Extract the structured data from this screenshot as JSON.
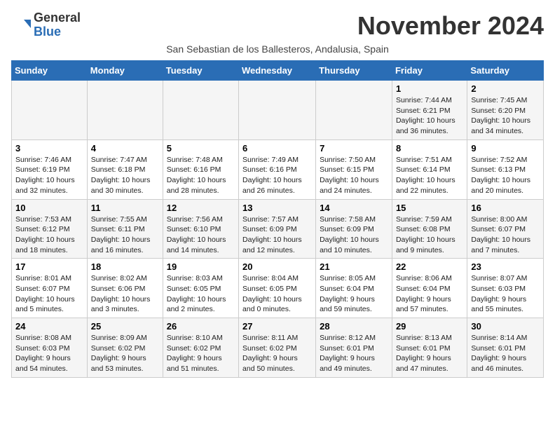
{
  "logo": {
    "general": "General",
    "blue": "Blue"
  },
  "title": "November 2024",
  "subtitle": "San Sebastian de los Ballesteros, Andalusia, Spain",
  "headers": [
    "Sunday",
    "Monday",
    "Tuesday",
    "Wednesday",
    "Thursday",
    "Friday",
    "Saturday"
  ],
  "weeks": [
    [
      {
        "day": "",
        "info": ""
      },
      {
        "day": "",
        "info": ""
      },
      {
        "day": "",
        "info": ""
      },
      {
        "day": "",
        "info": ""
      },
      {
        "day": "",
        "info": ""
      },
      {
        "day": "1",
        "info": "Sunrise: 7:44 AM\nSunset: 6:21 PM\nDaylight: 10 hours and 36 minutes."
      },
      {
        "day": "2",
        "info": "Sunrise: 7:45 AM\nSunset: 6:20 PM\nDaylight: 10 hours and 34 minutes."
      }
    ],
    [
      {
        "day": "3",
        "info": "Sunrise: 7:46 AM\nSunset: 6:19 PM\nDaylight: 10 hours and 32 minutes."
      },
      {
        "day": "4",
        "info": "Sunrise: 7:47 AM\nSunset: 6:18 PM\nDaylight: 10 hours and 30 minutes."
      },
      {
        "day": "5",
        "info": "Sunrise: 7:48 AM\nSunset: 6:16 PM\nDaylight: 10 hours and 28 minutes."
      },
      {
        "day": "6",
        "info": "Sunrise: 7:49 AM\nSunset: 6:16 PM\nDaylight: 10 hours and 26 minutes."
      },
      {
        "day": "7",
        "info": "Sunrise: 7:50 AM\nSunset: 6:15 PM\nDaylight: 10 hours and 24 minutes."
      },
      {
        "day": "8",
        "info": "Sunrise: 7:51 AM\nSunset: 6:14 PM\nDaylight: 10 hours and 22 minutes."
      },
      {
        "day": "9",
        "info": "Sunrise: 7:52 AM\nSunset: 6:13 PM\nDaylight: 10 hours and 20 minutes."
      }
    ],
    [
      {
        "day": "10",
        "info": "Sunrise: 7:53 AM\nSunset: 6:12 PM\nDaylight: 10 hours and 18 minutes."
      },
      {
        "day": "11",
        "info": "Sunrise: 7:55 AM\nSunset: 6:11 PM\nDaylight: 10 hours and 16 minutes."
      },
      {
        "day": "12",
        "info": "Sunrise: 7:56 AM\nSunset: 6:10 PM\nDaylight: 10 hours and 14 minutes."
      },
      {
        "day": "13",
        "info": "Sunrise: 7:57 AM\nSunset: 6:09 PM\nDaylight: 10 hours and 12 minutes."
      },
      {
        "day": "14",
        "info": "Sunrise: 7:58 AM\nSunset: 6:09 PM\nDaylight: 10 hours and 10 minutes."
      },
      {
        "day": "15",
        "info": "Sunrise: 7:59 AM\nSunset: 6:08 PM\nDaylight: 10 hours and 9 minutes."
      },
      {
        "day": "16",
        "info": "Sunrise: 8:00 AM\nSunset: 6:07 PM\nDaylight: 10 hours and 7 minutes."
      }
    ],
    [
      {
        "day": "17",
        "info": "Sunrise: 8:01 AM\nSunset: 6:07 PM\nDaylight: 10 hours and 5 minutes."
      },
      {
        "day": "18",
        "info": "Sunrise: 8:02 AM\nSunset: 6:06 PM\nDaylight: 10 hours and 3 minutes."
      },
      {
        "day": "19",
        "info": "Sunrise: 8:03 AM\nSunset: 6:05 PM\nDaylight: 10 hours and 2 minutes."
      },
      {
        "day": "20",
        "info": "Sunrise: 8:04 AM\nSunset: 6:05 PM\nDaylight: 10 hours and 0 minutes."
      },
      {
        "day": "21",
        "info": "Sunrise: 8:05 AM\nSunset: 6:04 PM\nDaylight: 9 hours and 59 minutes."
      },
      {
        "day": "22",
        "info": "Sunrise: 8:06 AM\nSunset: 6:04 PM\nDaylight: 9 hours and 57 minutes."
      },
      {
        "day": "23",
        "info": "Sunrise: 8:07 AM\nSunset: 6:03 PM\nDaylight: 9 hours and 55 minutes."
      }
    ],
    [
      {
        "day": "24",
        "info": "Sunrise: 8:08 AM\nSunset: 6:03 PM\nDaylight: 9 hours and 54 minutes."
      },
      {
        "day": "25",
        "info": "Sunrise: 8:09 AM\nSunset: 6:02 PM\nDaylight: 9 hours and 53 minutes."
      },
      {
        "day": "26",
        "info": "Sunrise: 8:10 AM\nSunset: 6:02 PM\nDaylight: 9 hours and 51 minutes."
      },
      {
        "day": "27",
        "info": "Sunrise: 8:11 AM\nSunset: 6:02 PM\nDaylight: 9 hours and 50 minutes."
      },
      {
        "day": "28",
        "info": "Sunrise: 8:12 AM\nSunset: 6:01 PM\nDaylight: 9 hours and 49 minutes."
      },
      {
        "day": "29",
        "info": "Sunrise: 8:13 AM\nSunset: 6:01 PM\nDaylight: 9 hours and 47 minutes."
      },
      {
        "day": "30",
        "info": "Sunrise: 8:14 AM\nSunset: 6:01 PM\nDaylight: 9 hours and 46 minutes."
      }
    ]
  ]
}
